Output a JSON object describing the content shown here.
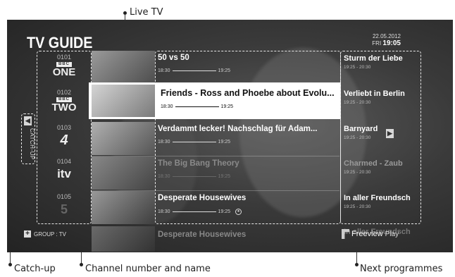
{
  "annotations": {
    "live_tv": "Live TV",
    "catch_up": "Catch-up",
    "channel_number_and_name": "Channel number and name",
    "next_programmes": "Next programmes"
  },
  "guide": {
    "title": "TV GUIDE",
    "date": "22.05.2012",
    "day": "FRI",
    "time": "19:05",
    "catch_up_label": "CATCH-UP",
    "group_label": "GROUP : TV",
    "brand": "Freeview",
    "brand_suffix": "Play"
  },
  "channels": [
    {
      "number": "0101",
      "badge": "BBC",
      "name": "ONE"
    },
    {
      "number": "0102",
      "badge": "BBC",
      "name": "TWO"
    },
    {
      "number": "0103",
      "badge": "",
      "name": "4"
    },
    {
      "number": "0104",
      "badge": "",
      "name": "itv"
    },
    {
      "number": "0105",
      "badge": "",
      "name": "5"
    }
  ],
  "programmes": [
    {
      "title": "50 vs 50",
      "start": "18:30",
      "end": "19:25",
      "thumb_color": "#8a8a8a"
    },
    {
      "title": "Friends - Ross and Phoebe about Evolu...",
      "start": "18:30",
      "end": "19:25",
      "thumb_color": "#b9b9b9"
    },
    {
      "title": "Verdammt lecker! Nachschlag für Adam...",
      "start": "18:30",
      "end": "19:25",
      "thumb_color": "#9d9d9d"
    },
    {
      "title": "The Big Bang Theory",
      "start": "18:30",
      "end": "19:25",
      "thumb_color": "#6e6e6e"
    },
    {
      "title": "Desperate Housewives",
      "start": "18:30",
      "end": "19:25",
      "thumb_color": "#7c7c7c"
    },
    {
      "title": "Desperate Housewives",
      "start": "",
      "end": "",
      "thumb_color": "#555555"
    }
  ],
  "next": [
    {
      "title": "Sturm der Liebe",
      "time": "19:25 - 20:30"
    },
    {
      "title": "Verliebt in Berlin",
      "time": "19:25 - 20:30"
    },
    {
      "title": "Barnyard",
      "time": "19:25 - 20:30"
    },
    {
      "title": "Charmed - Zaub",
      "time": "19:25 - 20:30"
    },
    {
      "title": "In aller Freundsch",
      "time": "19:25 - 20:30"
    },
    {
      "title": "In aller Freundsch",
      "time": ""
    }
  ]
}
